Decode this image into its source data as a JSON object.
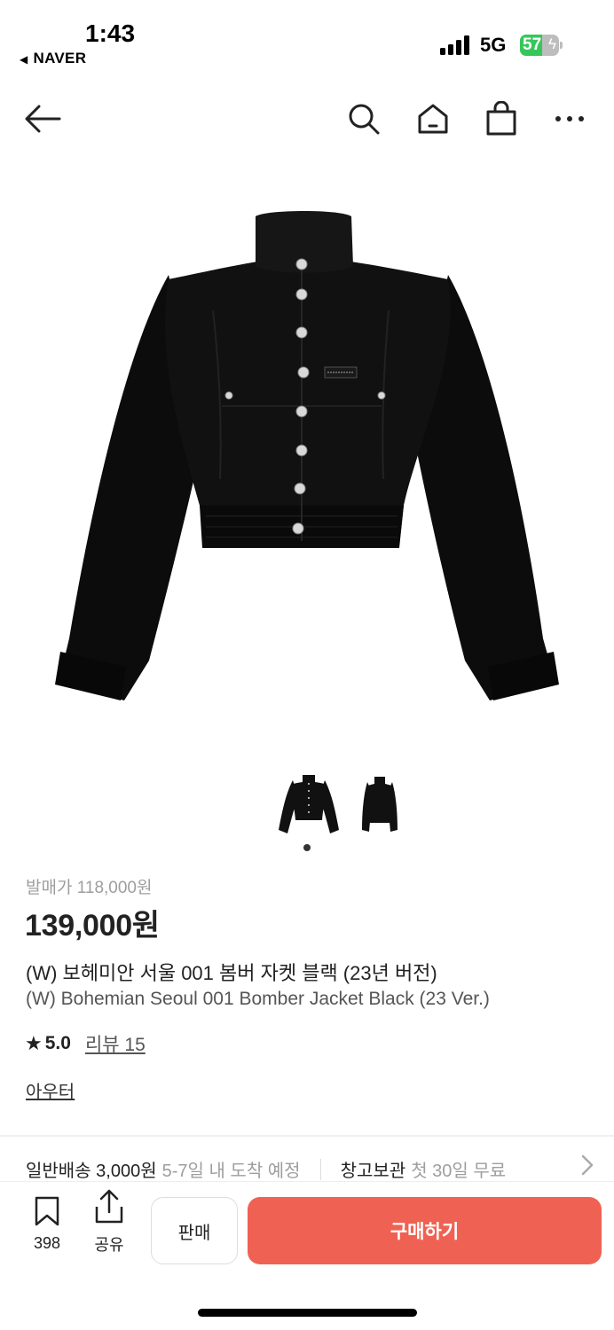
{
  "status_bar": {
    "time": "1:43",
    "back_app": "NAVER",
    "network": "5G",
    "battery": "57",
    "battery_level": 0.57
  },
  "product": {
    "release_price": "발매가 118,000원",
    "price": "139,000원",
    "name_ko": "(W) 보헤미안 서울 001 봄버 자켓 블랙 (23년 버전)",
    "name_en": "(W) Bohemian Seoul 001 Bomber Jacket Black (23 Ver.)",
    "rating": "5.0",
    "review_label": "리뷰 15",
    "category": "아우터",
    "brand_embroidery": "BOHEMIAN SEOUL"
  },
  "delivery": {
    "label": "일반배송 3,000원",
    "eta": "5-7일 내 도착 예정",
    "storage_label": "창고보관",
    "storage_note": "첫 30일 무료"
  },
  "bottom_bar": {
    "bookmark_count": "398",
    "share_label": "공유",
    "sell_label": "판매",
    "buy_label": "구매하기"
  },
  "colors": {
    "accent": "#ef6253",
    "battery_green": "#35c759"
  },
  "icons": [
    "back-arrow-icon",
    "search-icon",
    "home-icon",
    "shopping-bag-icon",
    "more-icon",
    "bookmark-icon",
    "share-icon",
    "star-icon",
    "chevron-right-icon"
  ]
}
